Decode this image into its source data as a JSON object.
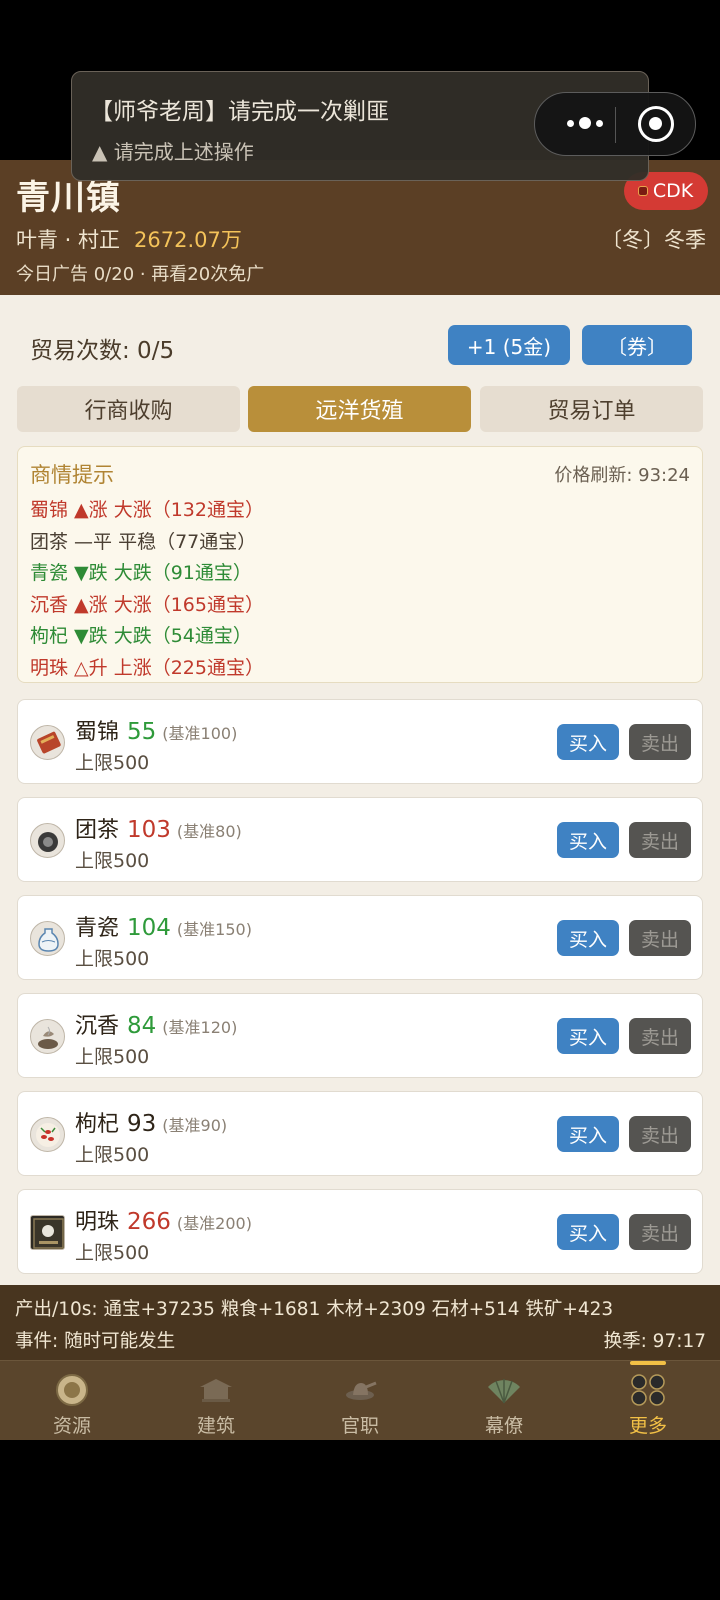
{
  "toast": {
    "title": "【师爷老周】请完成一次剿匪",
    "sub": "▲ 请完成上述操作"
  },
  "header": {
    "town": "青川镇",
    "cdk": "CDK",
    "player": "叶青 · 村正",
    "wealth": "2672.07万",
    "season": "〔冬〕冬季",
    "ads": "今日广告 0/20 · 再看20次免广"
  },
  "trade": {
    "count_label": "贸易次数: 0/5",
    "plus_button": "+1 (5金)",
    "coupon_button": "〔券〕"
  },
  "tabs": [
    {
      "label": "行商收购",
      "active": false
    },
    {
      "label": "远洋货殖",
      "active": true
    },
    {
      "label": "贸易订单",
      "active": false
    }
  ],
  "market": {
    "title": "商情提示",
    "refresh": "价格刷新: 93:24",
    "tips": [
      {
        "text": "蜀锦 ▲涨 大涨（132通宝）",
        "color": "#c0392b"
      },
      {
        "text": "团茶 —平 平稳（77通宝）",
        "color": "#4a3f33"
      },
      {
        "text": "青瓷 ▼跌 大跌（91通宝）",
        "color": "#2e8b36"
      },
      {
        "text": "沉香 ▲涨 大涨（165通宝）",
        "color": "#c0392b"
      },
      {
        "text": "枸杞 ▼跌 大跌（54通宝）",
        "color": "#2e8b36"
      },
      {
        "text": "明珠 △升 上涨（225通宝）",
        "color": "#c0392b"
      }
    ]
  },
  "items": [
    {
      "name": "蜀锦",
      "price": "55",
      "price_color": "#2e9a3a",
      "base": "(基准100)",
      "limit": "上限500",
      "buy": "买入",
      "sell": "卖出",
      "icon": "brocade-icon"
    },
    {
      "name": "团茶",
      "price": "103",
      "price_color": "#c0392b",
      "base": "(基准80)",
      "limit": "上限500",
      "buy": "买入",
      "sell": "卖出",
      "icon": "tea-icon"
    },
    {
      "name": "青瓷",
      "price": "104",
      "price_color": "#2e9a3a",
      "base": "(基准150)",
      "limit": "上限500",
      "buy": "买入",
      "sell": "卖出",
      "icon": "porcelain-icon"
    },
    {
      "name": "沉香",
      "price": "84",
      "price_color": "#2e9a3a",
      "base": "(基准120)",
      "limit": "上限500",
      "buy": "买入",
      "sell": "卖出",
      "icon": "incense-icon"
    },
    {
      "name": "枸杞",
      "price": "93",
      "price_color": "#2e2418",
      "base": "(基准90)",
      "limit": "上限500",
      "buy": "买入",
      "sell": "卖出",
      "icon": "goji-icon"
    },
    {
      "name": "明珠",
      "price": "266",
      "price_color": "#c0392b",
      "base": "(基准200)",
      "limit": "上限500",
      "buy": "买入",
      "sell": "卖出",
      "icon": "pearl-icon"
    }
  ],
  "info": {
    "output": "产出/10s: 通宝+37235 粮食+1681 木材+2309 石材+514 铁矿+423",
    "event": "事件: 随时可能发生",
    "swap": "换季: 97:17"
  },
  "nav": [
    {
      "label": "资源",
      "icon": "resource-icon",
      "active": false
    },
    {
      "label": "建筑",
      "icon": "building-icon",
      "active": false
    },
    {
      "label": "官职",
      "icon": "official-hat-icon",
      "active": false
    },
    {
      "label": "幕僚",
      "icon": "advisor-fan-icon",
      "active": false
    },
    {
      "label": "更多",
      "icon": "more-icon",
      "active": true
    }
  ],
  "colors": {
    "header_bg": "#5b3f25",
    "accent_gold": "#b98f3a",
    "blue": "#3f82c3"
  }
}
